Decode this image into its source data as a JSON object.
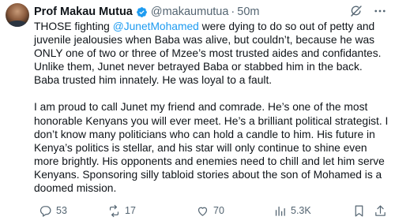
{
  "author": {
    "name": "Prof Makau Mutua",
    "handle": "@makaumutua",
    "separator": "·",
    "time": "50m"
  },
  "tweet": {
    "p1_before": "THOSE fighting ",
    "p1_mention": "@JunetMohamed",
    "p1_after": " were dying to do so out of petty and juvenile jealousies when Baba was alive, but couldn’t, because he was ONLY one of two or three of Mzee’s most trusted aides and confidantes. Unlike them, Junet never betrayed Baba or stabbed him in the back.  Baba trusted him innately.  He was loyal to a fault.",
    "p2": "I am proud to call Junet my friend and comrade.  He’s one of the most honorable Kenyans you will ever meet.  He’s a brilliant political strategist.  I don’t know many politicians who can hold a candle to him.  His future in Kenya’s politics is stellar, and his star will only continue to shine even more brightly.  His opponents and enemies need to chill and let him serve Kenyans.  Sponsoring silly tabloid stories about the son of Mohamed is a doomed mission."
  },
  "actions": {
    "replies": "53",
    "reposts": "17",
    "likes": "70",
    "views": "5.3K"
  },
  "icons": {
    "verified": "verified-badge-icon",
    "grok": "grok-icon",
    "more": "more-icon",
    "reply": "reply-icon",
    "repost": "repost-icon",
    "like": "heart-icon",
    "views": "views-icon",
    "bookmark": "bookmark-icon",
    "share": "share-icon"
  },
  "colors": {
    "accent": "#1d9bf0",
    "text": "#0f1419",
    "muted": "#536471"
  }
}
